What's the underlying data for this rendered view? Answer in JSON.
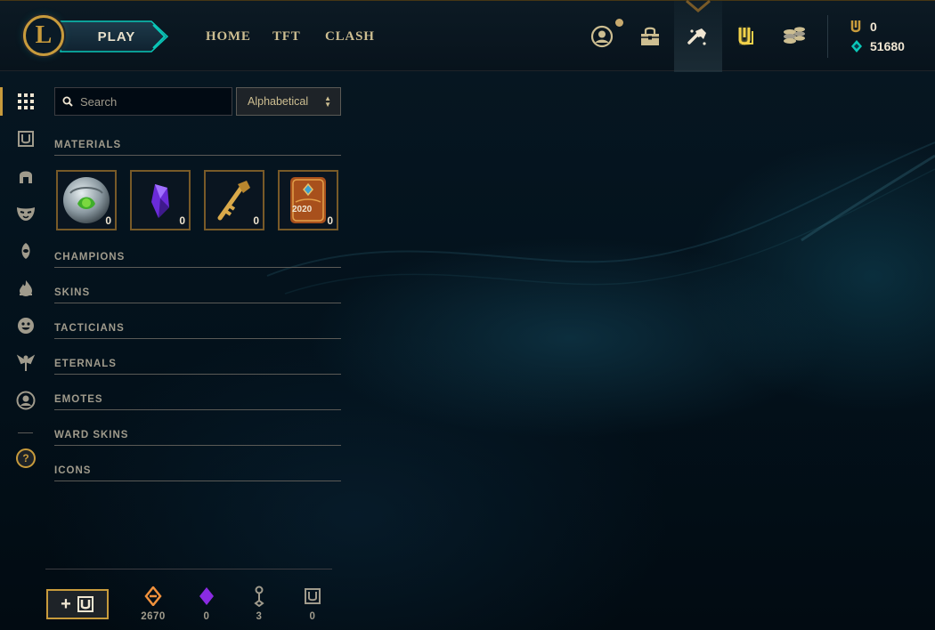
{
  "colors": {
    "gold": "#c89b3c",
    "gold_light": "#f0e6d2",
    "text_muted": "#a09b8c",
    "blue_essence": "#0ac8b9",
    "orange_essence": "#f0913c",
    "mythic_purple": "#8a2be2"
  },
  "header": {
    "logo_letter": "L",
    "play_label": "PLAY",
    "nav": [
      "HOME",
      "TFT",
      "CLASH"
    ],
    "icons": [
      "profile-icon",
      "collection-icon",
      "loot-icon",
      "store-icon",
      "rp-stack-icon"
    ],
    "currency": {
      "rp": "0",
      "blue_essence": "51680"
    }
  },
  "rail": {
    "icons": [
      "grid-icon",
      "chest-icon",
      "helmet-icon",
      "mask-icon",
      "ward-icon",
      "flame-icon",
      "emote-icon",
      "eternals-icon",
      "avatar-icon",
      "help-icon"
    ],
    "help_glyph": "?"
  },
  "search": {
    "placeholder": "Search",
    "value": "",
    "sort_selected": "Alphabetical"
  },
  "sections": {
    "materials": "MATERIALS",
    "champions": "CHAMPIONS",
    "skins": "SKINS",
    "tacticians": "TACTICIANS",
    "eternals": "ETERNALS",
    "emotes": "EMOTES",
    "ward_skins": "WARD SKINS",
    "icons": "ICONS"
  },
  "materials": [
    {
      "name": "orb",
      "count": "0"
    },
    {
      "name": "gemstone",
      "count": "0"
    },
    {
      "name": "key",
      "count": "0"
    },
    {
      "name": "capsule-2020",
      "count": "0",
      "label": "2020"
    }
  ],
  "bottom": {
    "craft_plus": "+",
    "resources": [
      {
        "name": "orange-essence",
        "value": "2670"
      },
      {
        "name": "mythic-essence",
        "value": "0"
      },
      {
        "name": "key-fragment",
        "value": "3"
      },
      {
        "name": "chest",
        "value": "0"
      }
    ]
  }
}
